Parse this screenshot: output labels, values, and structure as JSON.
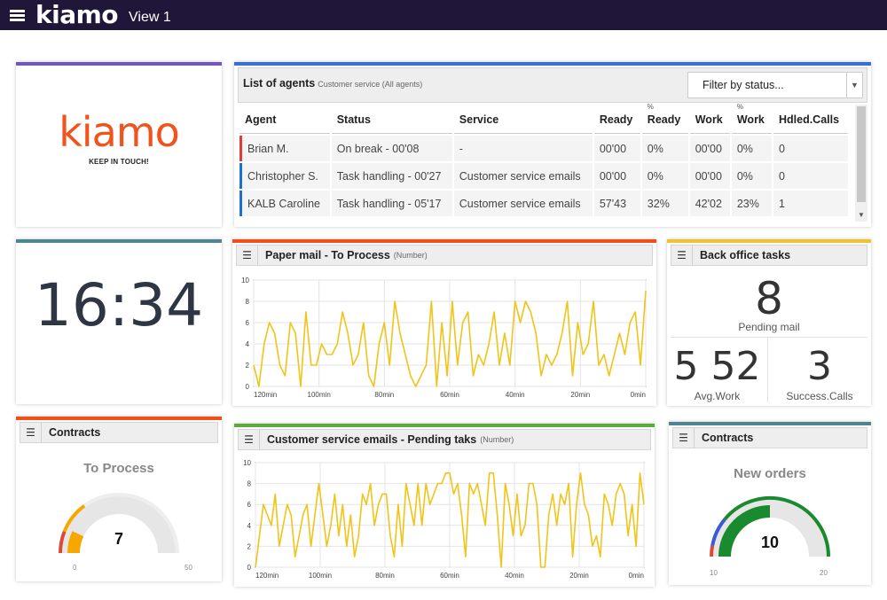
{
  "app": {
    "brand": "kiamo",
    "view": "View 1"
  },
  "colors": {
    "purple": "#7457bd",
    "blue": "#3a6fd6",
    "teal": "#4f8593",
    "orange": "#f05018",
    "yellow": "#f2c12e",
    "green": "#5cab3c",
    "line": "#f0c419",
    "gauge_orange": "#f7a800",
    "gauge_red": "#e0473b",
    "gauge_green": "#1a8a2e",
    "gauge_blue": "#3b5bd6"
  },
  "logo": {
    "word": "kiamo",
    "tagline": "KEEP IN TOUCH!"
  },
  "clock": {
    "time": "16:34"
  },
  "agents": {
    "title": "List of agents",
    "subtitle": "Customer service (All agents)",
    "filter_placeholder": "Filter by status...",
    "columns": [
      "Agent",
      "Status",
      "Service",
      "Ready",
      "% Ready",
      "Work",
      "% Work",
      "Hdled.Calls"
    ],
    "col_ready_pct": "Ready",
    "col_work_pct": "Work",
    "pct_mark": "%",
    "rows": [
      {
        "agent": "Brian M.",
        "status": "On break - 00'08",
        "service": "-",
        "ready": "00'00",
        "ready_pct": "0%",
        "work": "00'00",
        "work_pct": "0%",
        "calls": "0"
      },
      {
        "agent": "Christopher S.",
        "status": "Task handling - 00'27",
        "service": "Customer service emails",
        "ready": "00'00",
        "ready_pct": "0%",
        "work": "00'00",
        "work_pct": "0%",
        "calls": "0"
      },
      {
        "agent": "KALB Caroline",
        "status": "Task handling - 05'17",
        "service": "Customer service emails",
        "ready": "57'43",
        "ready_pct": "32%",
        "work": "42'02",
        "work_pct": "23%",
        "calls": "1"
      }
    ]
  },
  "paper_mail": {
    "title": "Paper mail - To Process",
    "subtitle": "(Number)"
  },
  "emails": {
    "title": "Customer service emails - Pending taks",
    "subtitle": "(Number)"
  },
  "back_office": {
    "title": "Back office tasks",
    "pending_value": "8",
    "pending_label": "Pending mail",
    "avg_value": "5 52",
    "avg_label": "Avg.Work",
    "success_value": "3",
    "success_label": "Success.Calls"
  },
  "contracts_left": {
    "title": "Contracts",
    "gauge_title": "To Process",
    "value_text": "7",
    "min_text": "0",
    "max_text": "50"
  },
  "contracts_right": {
    "title": "Contracts",
    "gauge_title": "New orders",
    "value_text": "10",
    "min_text": "10",
    "max_text": "20"
  },
  "chart_data": [
    {
      "type": "line",
      "title": "Paper mail - To Process",
      "x_ticks": [
        "120min",
        "100min",
        "80min",
        "60min",
        "40min",
        "20min",
        "0min"
      ],
      "y_ticks": [
        "0",
        "2",
        "4",
        "6",
        "8",
        "10"
      ],
      "ylim": [
        0,
        10
      ],
      "grid": true,
      "values": [
        2,
        0,
        4,
        6,
        5,
        2,
        1,
        6,
        5,
        0,
        7,
        2,
        2,
        4,
        3,
        3,
        4,
        7,
        5,
        2,
        3,
        6,
        1,
        0,
        4,
        6,
        2,
        8,
        5,
        3,
        1,
        0,
        1,
        2,
        8,
        0,
        6,
        1,
        8,
        2,
        6,
        7,
        1,
        3,
        2,
        4,
        7,
        2,
        5,
        2,
        8,
        6,
        8,
        7,
        5,
        1,
        3,
        2,
        3,
        5,
        8,
        1,
        6,
        3,
        4,
        8,
        2,
        3,
        1,
        3,
        5,
        3,
        6,
        7,
        2,
        9
      ]
    },
    {
      "type": "line",
      "title": "Customer service emails - Pending taks",
      "x_ticks": [
        "120min",
        "100min",
        "80min",
        "60min",
        "40min",
        "20min",
        "0min"
      ],
      "y_ticks": [
        "0",
        "2",
        "4",
        "6",
        "8",
        "10"
      ],
      "ylim": [
        0,
        10
      ],
      "grid": true,
      "values": [
        0,
        3,
        6,
        5,
        4,
        7,
        2,
        4,
        6,
        5,
        1,
        3,
        5,
        6,
        2,
        5,
        8,
        5,
        2,
        4,
        7,
        3,
        6,
        2,
        5,
        1,
        3,
        7,
        6,
        8,
        4,
        6,
        7,
        7,
        3,
        1,
        6,
        2,
        8,
        6,
        4,
        8,
        4,
        8,
        6,
        7,
        8,
        8,
        9,
        9,
        7,
        8,
        5,
        1,
        8,
        7,
        8,
        6,
        4,
        9,
        9,
        5,
        0,
        8,
        6,
        3,
        7,
        3,
        4,
        8,
        8,
        6,
        0,
        0,
        5,
        7,
        4,
        7,
        6,
        8,
        1,
        6,
        9,
        6,
        5,
        2,
        3,
        1,
        7,
        6,
        4,
        7,
        8,
        7,
        3,
        6,
        2,
        9,
        6
      ]
    },
    {
      "type": "gauge",
      "title": "To Process",
      "value": 7,
      "range": [
        0,
        50
      ]
    },
    {
      "type": "gauge",
      "title": "New orders",
      "value": 10,
      "range": [
        0,
        20
      ]
    }
  ]
}
